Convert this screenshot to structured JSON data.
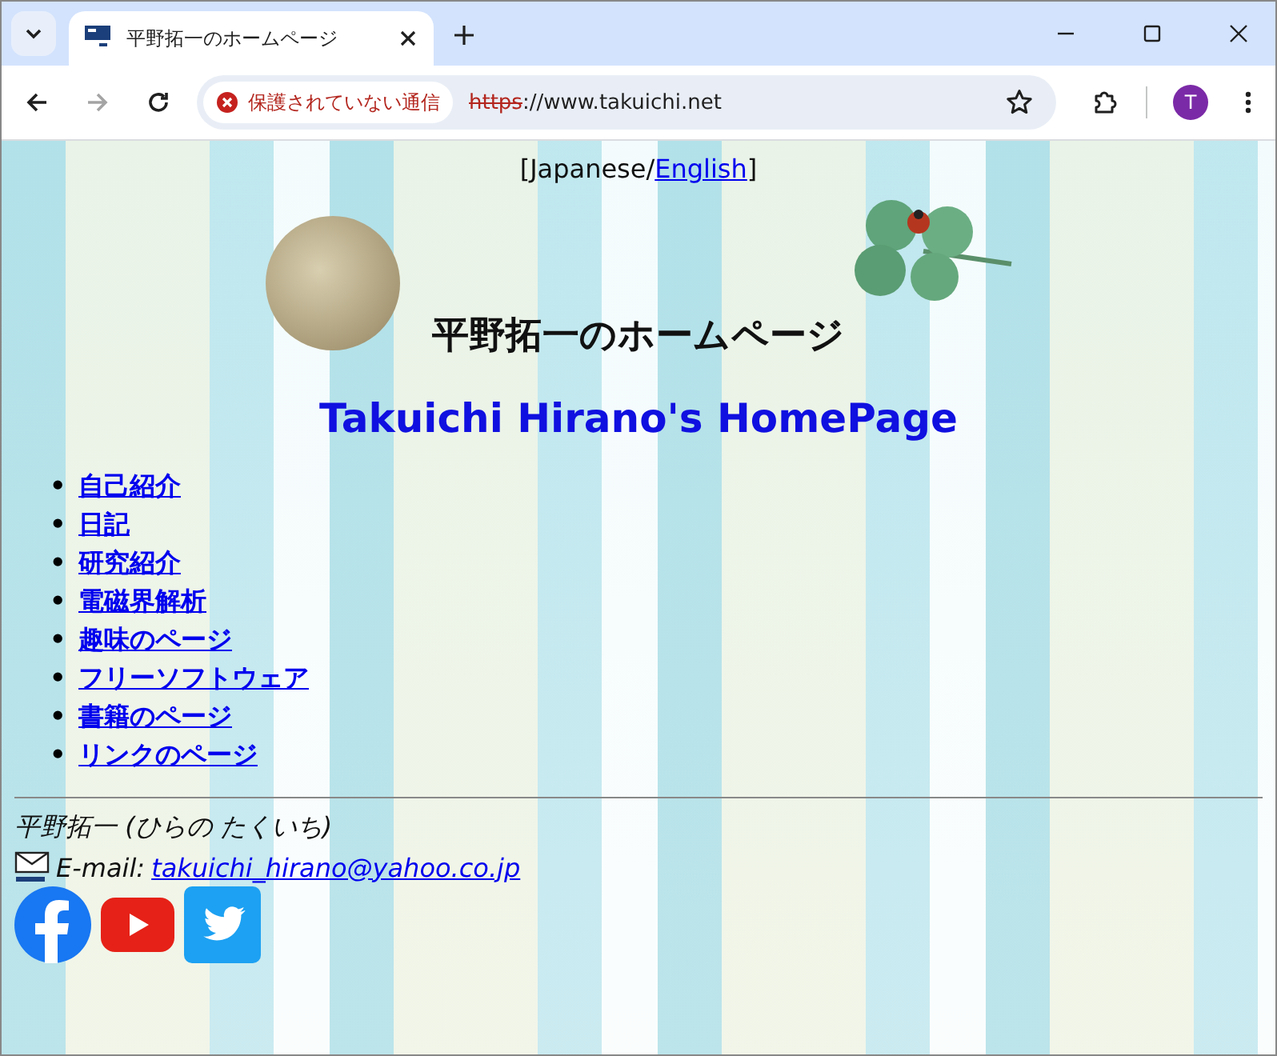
{
  "window": {
    "tab_title": "平野拓一のホームページ"
  },
  "nav_buttons": [
    {
      "kind": "back",
      "disabled": false
    },
    {
      "kind": "forward",
      "disabled": true
    },
    {
      "kind": "reload",
      "disabled": false
    }
  ],
  "address": {
    "security": "保護されていない通信",
    "scheme": "https",
    "scheme_struck": true,
    "rest": "://www.takuichi.net"
  },
  "profile": {
    "initial": "T"
  },
  "page": {
    "lang_open": "[",
    "lang_sep": "/",
    "lang_close": "]",
    "languages": [
      {
        "label": "Japanese",
        "selected": true
      },
      {
        "label": "English",
        "selected": false
      }
    ],
    "title_ja": "平野拓一のホームページ",
    "title_en": "Takuichi Hirano's HomePage",
    "menu": [
      {
        "marker": "•",
        "label": "自己紹介"
      },
      {
        "marker": "•",
        "label": "日記"
      },
      {
        "marker": "•",
        "label": "研究紹介"
      },
      {
        "marker": "•",
        "label": "電磁界解析"
      },
      {
        "marker": "•",
        "label": "趣味のページ"
      },
      {
        "marker": "•",
        "label": "フリーソフトウェア"
      },
      {
        "marker": "•",
        "label": "書籍のページ"
      },
      {
        "marker": "•",
        "label": "リンクのページ"
      }
    ],
    "author": "平野拓一 (ひらの たくいち)",
    "email_label": "E-mail:",
    "email": "takuichi_hirano@yahoo.co.jp",
    "social": [
      {
        "kind": "facebook"
      },
      {
        "kind": "youtube"
      },
      {
        "kind": "twitter"
      }
    ]
  }
}
